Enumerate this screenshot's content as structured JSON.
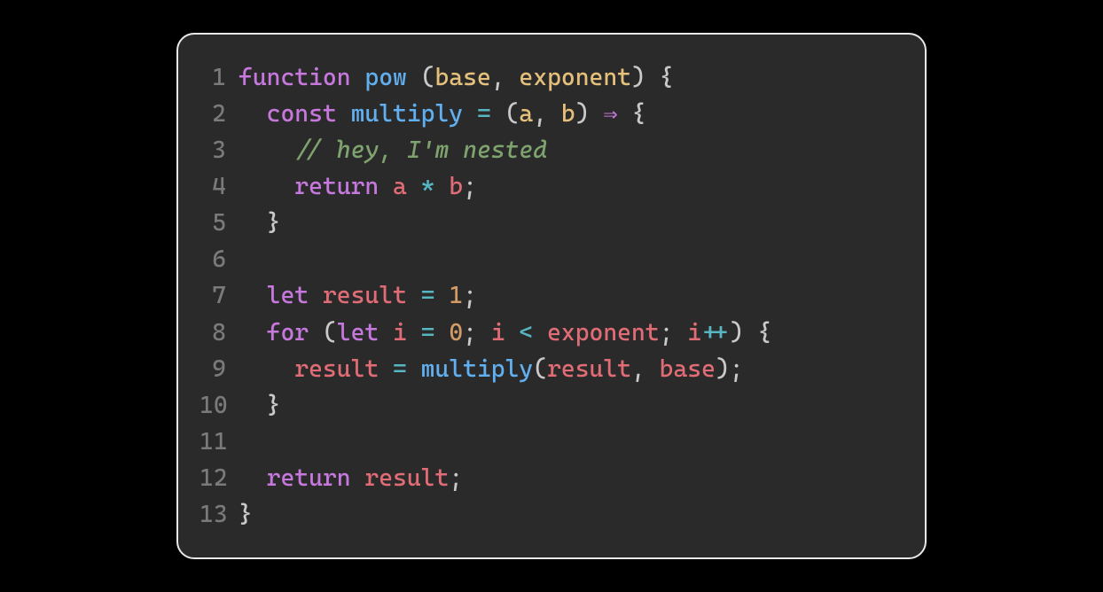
{
  "colors": {
    "background": "#2a2a2a",
    "frame_border": "#e8e8e8",
    "gutter": "#7a7a7a",
    "keyword": "#c678dd",
    "funcname": "#61afef",
    "param": "#e5c07b",
    "ident": "#e06c75",
    "var": "#56b6c2",
    "comment": "#7ea36e",
    "number": "#d19a66",
    "operator": "#56b6c2",
    "punct": "#c9c9c9",
    "default": "#d8d8d8"
  },
  "code": {
    "language": "javascript",
    "lines": [
      {
        "num": "1",
        "tokens": [
          {
            "t": "function ",
            "c": "keyword"
          },
          {
            "t": "pow ",
            "c": "funcname"
          },
          {
            "t": "(",
            "c": "punct"
          },
          {
            "t": "base",
            "c": "param"
          },
          {
            "t": ", ",
            "c": "punct"
          },
          {
            "t": "exponent",
            "c": "param"
          },
          {
            "t": ") {",
            "c": "punct"
          }
        ]
      },
      {
        "num": "2",
        "tokens": [
          {
            "t": "  ",
            "c": "default"
          },
          {
            "t": "const ",
            "c": "keyword"
          },
          {
            "t": "multiply ",
            "c": "funcname"
          },
          {
            "t": "= ",
            "c": "operator"
          },
          {
            "t": "(",
            "c": "punct"
          },
          {
            "t": "a",
            "c": "param"
          },
          {
            "t": ", ",
            "c": "punct"
          },
          {
            "t": "b",
            "c": "param"
          },
          {
            "t": ") ",
            "c": "punct"
          },
          {
            "t": "⇒",
            "c": "arrow"
          },
          {
            "t": " {",
            "c": "punct"
          }
        ]
      },
      {
        "num": "3",
        "tokens": [
          {
            "t": "    ",
            "c": "default"
          },
          {
            "t": "// hey, I'm nested",
            "c": "comment"
          }
        ]
      },
      {
        "num": "4",
        "tokens": [
          {
            "t": "    ",
            "c": "default"
          },
          {
            "t": "return ",
            "c": "keyword"
          },
          {
            "t": "a ",
            "c": "ident"
          },
          {
            "t": "* ",
            "c": "operator"
          },
          {
            "t": "b",
            "c": "ident"
          },
          {
            "t": ";",
            "c": "punct"
          }
        ]
      },
      {
        "num": "5",
        "tokens": [
          {
            "t": "  }",
            "c": "punct"
          }
        ]
      },
      {
        "num": "6",
        "tokens": [
          {
            "t": "",
            "c": "default"
          }
        ]
      },
      {
        "num": "7",
        "tokens": [
          {
            "t": "  ",
            "c": "default"
          },
          {
            "t": "let ",
            "c": "keyword"
          },
          {
            "t": "result ",
            "c": "ident"
          },
          {
            "t": "= ",
            "c": "operator"
          },
          {
            "t": "1",
            "c": "number"
          },
          {
            "t": ";",
            "c": "punct"
          }
        ]
      },
      {
        "num": "8",
        "tokens": [
          {
            "t": "  ",
            "c": "default"
          },
          {
            "t": "for ",
            "c": "keyword"
          },
          {
            "t": "(",
            "c": "punct"
          },
          {
            "t": "let ",
            "c": "keyword"
          },
          {
            "t": "i ",
            "c": "ident"
          },
          {
            "t": "= ",
            "c": "operator"
          },
          {
            "t": "0",
            "c": "number"
          },
          {
            "t": "; ",
            "c": "punct"
          },
          {
            "t": "i ",
            "c": "ident"
          },
          {
            "t": "< ",
            "c": "operator"
          },
          {
            "t": "exponent",
            "c": "ident"
          },
          {
            "t": "; ",
            "c": "punct"
          },
          {
            "t": "i",
            "c": "ident"
          },
          {
            "t": "++",
            "c": "operator"
          },
          {
            "t": ") {",
            "c": "punct"
          }
        ]
      },
      {
        "num": "9",
        "tokens": [
          {
            "t": "    ",
            "c": "default"
          },
          {
            "t": "result ",
            "c": "ident"
          },
          {
            "t": "= ",
            "c": "operator"
          },
          {
            "t": "multiply",
            "c": "funcname"
          },
          {
            "t": "(",
            "c": "punct"
          },
          {
            "t": "result",
            "c": "ident"
          },
          {
            "t": ", ",
            "c": "punct"
          },
          {
            "t": "base",
            "c": "ident"
          },
          {
            "t": ");",
            "c": "punct"
          }
        ]
      },
      {
        "num": "10",
        "tokens": [
          {
            "t": "  }",
            "c": "punct"
          }
        ]
      },
      {
        "num": "11",
        "tokens": [
          {
            "t": "",
            "c": "default"
          }
        ]
      },
      {
        "num": "12",
        "tokens": [
          {
            "t": "  ",
            "c": "default"
          },
          {
            "t": "return ",
            "c": "keyword"
          },
          {
            "t": "result",
            "c": "ident"
          },
          {
            "t": ";",
            "c": "punct"
          }
        ]
      },
      {
        "num": "13",
        "tokens": [
          {
            "t": "}",
            "c": "punct"
          }
        ]
      }
    ]
  }
}
